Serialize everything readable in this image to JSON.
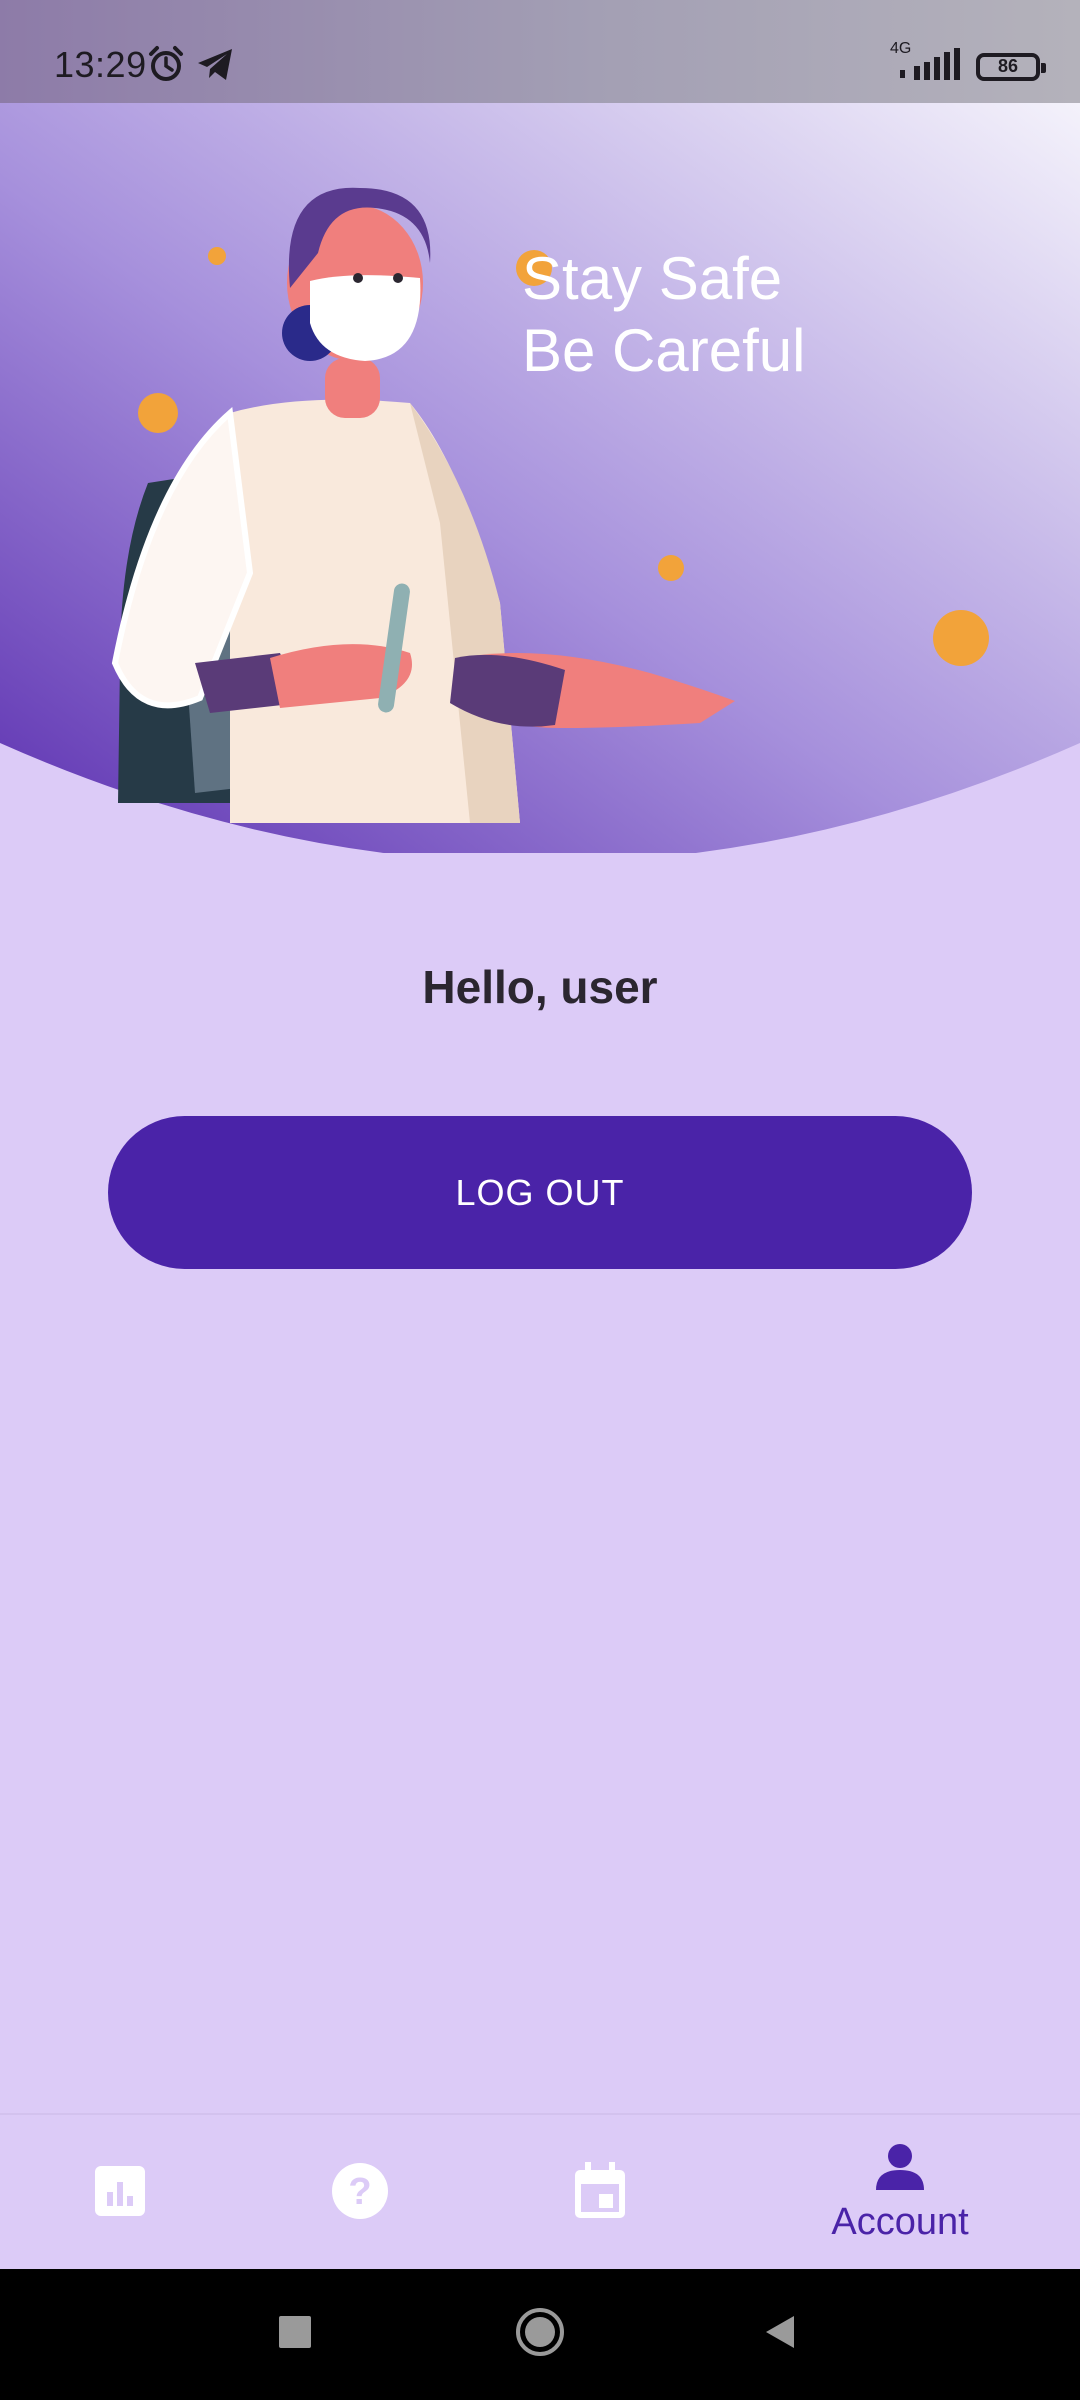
{
  "status_bar": {
    "time": "13:29",
    "network": "4G",
    "battery": "86"
  },
  "hero": {
    "line1": "Stay Safe",
    "line2": "Be Careful"
  },
  "greeting": "Hello, user",
  "logout_label": "LOG OUT",
  "bottom_nav": {
    "items": [
      {
        "icon": "stats-icon",
        "label": ""
      },
      {
        "icon": "help-icon",
        "label": ""
      },
      {
        "icon": "calendar-icon",
        "label": ""
      },
      {
        "icon": "account-icon",
        "label": "Account",
        "active": true
      }
    ]
  },
  "colors": {
    "accent": "#4a23a8",
    "background": "#dccbf7",
    "hero_dark": "#6a3fbc"
  }
}
